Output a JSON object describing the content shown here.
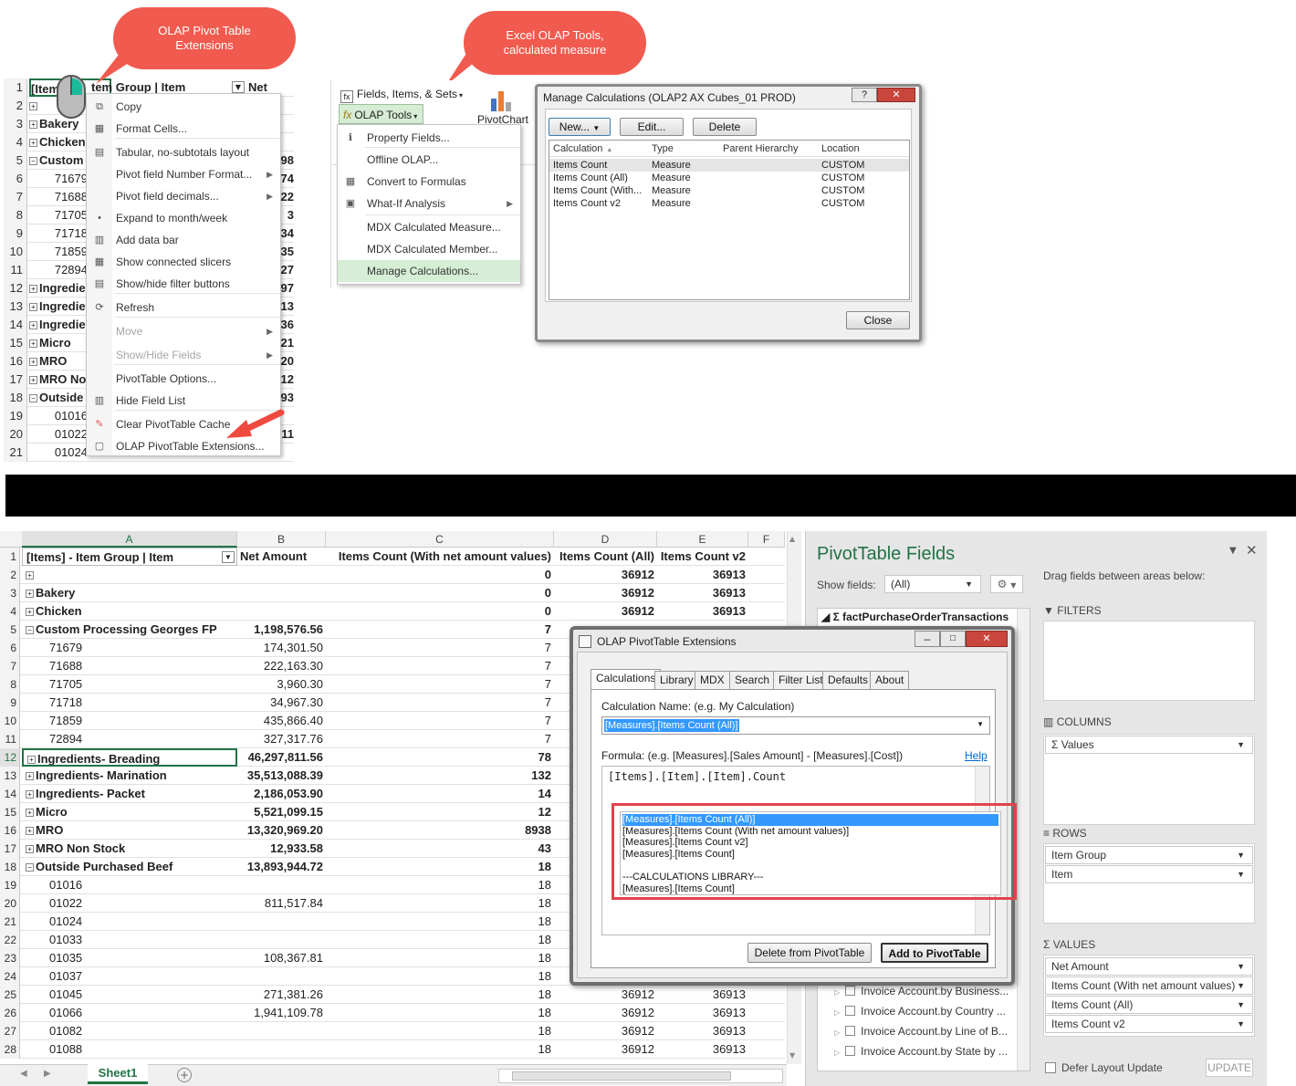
{
  "callouts": {
    "pivot_ext": "OLAP Pivot Table\nExtensions",
    "olap_tools": "Excel OLAP Tools,\ncalculated measure"
  },
  "top_grid": {
    "header_cell": "[Items] - Item Group | Item",
    "header_b": "Net Amo",
    "rows": [
      {
        "n": "1",
        "a": "[Item",
        "b": ""
      },
      {
        "n": "2",
        "a": "",
        "b": "",
        "pm": "+"
      },
      {
        "n": "3",
        "a": "Bakery",
        "b": "",
        "pm": "+"
      },
      {
        "n": "4",
        "a": "Chicken",
        "b": "",
        "pm": "+"
      },
      {
        "n": "5",
        "a": "Custom",
        "b": "98",
        "pm": "-"
      },
      {
        "n": "6",
        "a": "71679",
        "b": "74"
      },
      {
        "n": "7",
        "a": "71688",
        "b": "22"
      },
      {
        "n": "8",
        "a": "71705",
        "b": "3"
      },
      {
        "n": "9",
        "a": "71718",
        "b": "34"
      },
      {
        "n": "10",
        "a": "71859",
        "b": "35"
      },
      {
        "n": "11",
        "a": "72894",
        "b": "27"
      },
      {
        "n": "12",
        "a": "Ingredie",
        "b": "97",
        "pm": "+"
      },
      {
        "n": "13",
        "a": "Ingredie",
        "b": "13",
        "pm": "+"
      },
      {
        "n": "14",
        "a": "Ingredie",
        "b": "36",
        "pm": "+"
      },
      {
        "n": "15",
        "a": "Micro",
        "b": "21",
        "pm": "+"
      },
      {
        "n": "16",
        "a": "MRO",
        "b": "20",
        "pm": "+"
      },
      {
        "n": "17",
        "a": "MRO No",
        "b": "12",
        "pm": "+"
      },
      {
        "n": "18",
        "a": "Outside",
        "b": "93",
        "pm": "-"
      },
      {
        "n": "19",
        "a": "01016",
        "b": ""
      },
      {
        "n": "20",
        "a": "01022",
        "b": "11"
      },
      {
        "n": "21",
        "a": "01024",
        "b": ""
      }
    ]
  },
  "context_menu": [
    {
      "label": "Copy",
      "icon": "copy-icon",
      "dis": false
    },
    {
      "label": "Format Cells...",
      "icon": "format-cells-icon",
      "dis": false
    },
    {
      "label": "Tabular, no-subtotals layout",
      "icon": "table-layout-icon",
      "dis": false
    },
    {
      "label": "Pivot field Number Format...",
      "icon": "",
      "dis": false,
      "arrow": true
    },
    {
      "label": "Pivot field decimals...",
      "icon": "",
      "dis": false,
      "arrow": true
    },
    {
      "label": "Expand to month/week",
      "icon": "dot-icon",
      "dis": false
    },
    {
      "label": "Add data bar",
      "icon": "data-bar-icon",
      "dis": false
    },
    {
      "label": "Show connected slicers",
      "icon": "slicer-icon",
      "dis": false
    },
    {
      "label": "Show/hide filter buttons",
      "icon": "filter-buttons-icon",
      "dis": false
    },
    {
      "label": "Refresh",
      "icon": "refresh-icon",
      "dis": false
    },
    {
      "label": "Move",
      "icon": "",
      "dis": true,
      "arrow": true
    },
    {
      "label": "Show/Hide Fields",
      "icon": "",
      "dis": true,
      "arrow": true
    },
    {
      "label": "PivotTable Options...",
      "icon": "",
      "dis": false
    },
    {
      "label": "Hide Field List",
      "icon": "field-list-icon",
      "dis": false
    },
    {
      "label": "Clear PivotTable Cache",
      "icon": "eraser-icon",
      "dis": false
    },
    {
      "label": "OLAP PivotTable Extensions...",
      "icon": "cube-icon",
      "dis": false
    }
  ],
  "ribbon": {
    "fields_items_sets": "Fields, Items, & Sets",
    "olap_tools": "OLAP Tools",
    "pivotchart": "PivotChart",
    "menu": [
      {
        "label": "Property Fields...",
        "icon": "info-icon"
      },
      {
        "label": "Offline OLAP...",
        "icon": ""
      },
      {
        "label": "Convert to Formulas",
        "icon": "convert-icon"
      },
      {
        "label": "What-If Analysis",
        "icon": "whatif-icon",
        "arrow": true
      },
      {
        "label": "MDX Calculated Measure...",
        "icon": ""
      },
      {
        "label": "MDX Calculated Member...",
        "icon": ""
      },
      {
        "label": "Manage Calculations...",
        "icon": "",
        "selected": true
      }
    ]
  },
  "manage_calc": {
    "title": "Manage Calculations (OLAP2 AX Cubes_01 PROD)",
    "new": "New...",
    "edit": "Edit...",
    "delete": "Delete",
    "close": "Close",
    "columns": [
      "Calculation",
      "Type",
      "Parent Hierarchy",
      "Location"
    ],
    "rows": [
      {
        "name": "Items Count",
        "type": "Measure",
        "parent": "",
        "loc": "CUSTOM"
      },
      {
        "name": "Items Count (All)",
        "type": "Measure",
        "parent": "",
        "loc": "CUSTOM"
      },
      {
        "name": "Items Count (With...",
        "type": "Measure",
        "parent": "",
        "loc": "CUSTOM"
      },
      {
        "name": "Items Count v2",
        "type": "Measure",
        "parent": "",
        "loc": "CUSTOM"
      }
    ]
  },
  "grid": {
    "col_letters": [
      "A",
      "B",
      "C",
      "D",
      "E",
      "F"
    ],
    "headers": {
      "a": "[Items] - Item Group | Item",
      "b": "Net Amount",
      "c": "Items Count (With net amount values)",
      "d": "Items Count (All)",
      "e": "Items Count v2"
    },
    "rows": [
      {
        "n": "2",
        "a": "",
        "b": "",
        "c": "0",
        "d": "36912",
        "e": "36913",
        "pm": "+"
      },
      {
        "n": "3",
        "a": "Bakery",
        "b": "",
        "c": "0",
        "d": "36912",
        "e": "36913",
        "pm": "+"
      },
      {
        "n": "4",
        "a": "Chicken",
        "b": "",
        "c": "0",
        "d": "36912",
        "e": "36913",
        "pm": "+"
      },
      {
        "n": "5",
        "a": "Custom Processing Georges FP",
        "b": "1,198,576.56",
        "c": "7",
        "d": "",
        "e": "",
        "pm": "-"
      },
      {
        "n": "6",
        "a": "71679",
        "b": "174,301.50",
        "c": "7",
        "d": "",
        "e": ""
      },
      {
        "n": "7",
        "a": "71688",
        "b": "222,163.30",
        "c": "7",
        "d": "",
        "e": ""
      },
      {
        "n": "8",
        "a": "71705",
        "b": "3,960.30",
        "c": "7",
        "d": "",
        "e": ""
      },
      {
        "n": "9",
        "a": "71718",
        "b": "34,967.30",
        "c": "7",
        "d": "",
        "e": ""
      },
      {
        "n": "10",
        "a": "71859",
        "b": "435,866.40",
        "c": "7",
        "d": "",
        "e": ""
      },
      {
        "n": "11",
        "a": "72894",
        "b": "327,317.76",
        "c": "7",
        "d": "",
        "e": ""
      },
      {
        "n": "12",
        "a": "Ingredients- Breading",
        "b": "46,297,811.56",
        "c": "78",
        "d": "",
        "e": "",
        "pm": "+"
      },
      {
        "n": "13",
        "a": "Ingredients- Marination",
        "b": "35,513,088.39",
        "c": "132",
        "d": "",
        "e": "",
        "pm": "+"
      },
      {
        "n": "14",
        "a": "Ingredients- Packet",
        "b": "2,186,053.90",
        "c": "14",
        "d": "",
        "e": "",
        "pm": "+"
      },
      {
        "n": "15",
        "a": "Micro",
        "b": "5,521,099.15",
        "c": "12",
        "d": "",
        "e": "",
        "pm": "+"
      },
      {
        "n": "16",
        "a": "MRO",
        "b": "13,320,969.20",
        "c": "8938",
        "d": "",
        "e": "",
        "pm": "+"
      },
      {
        "n": "17",
        "a": "MRO Non Stock",
        "b": "12,933.58",
        "c": "43",
        "d": "",
        "e": "",
        "pm": "+"
      },
      {
        "n": "18",
        "a": "Outside Purchased Beef",
        "b": "13,893,944.72",
        "c": "18",
        "d": "",
        "e": "",
        "pm": "-"
      },
      {
        "n": "19",
        "a": "01016",
        "b": "",
        "c": "18",
        "d": "",
        "e": ""
      },
      {
        "n": "20",
        "a": "01022",
        "b": "811,517.84",
        "c": "18",
        "d": "",
        "e": ""
      },
      {
        "n": "21",
        "a": "01024",
        "b": "",
        "c": "18",
        "d": "",
        "e": ""
      },
      {
        "n": "22",
        "a": "01033",
        "b": "",
        "c": "18",
        "d": "",
        "e": ""
      },
      {
        "n": "23",
        "a": "01035",
        "b": "108,367.81",
        "c": "18",
        "d": "",
        "e": ""
      },
      {
        "n": "24",
        "a": "01037",
        "b": "",
        "c": "18",
        "d": "",
        "e": ""
      },
      {
        "n": "25",
        "a": "01045",
        "b": "271,381.26",
        "c": "18",
        "d": "36912",
        "e": "36913"
      },
      {
        "n": "26",
        "a": "01066",
        "b": "1,941,109.78",
        "c": "18",
        "d": "36912",
        "e": "36913"
      },
      {
        "n": "27",
        "a": "01082",
        "b": "",
        "c": "18",
        "d": "36912",
        "e": "36913"
      },
      {
        "n": "28",
        "a": "01088",
        "b": "",
        "c": "18",
        "d": "36912",
        "e": "36913"
      }
    ],
    "sheet_tab": "Sheet1"
  },
  "ext_dialog": {
    "title": "OLAP PivotTable Extensions",
    "tabs": [
      "Calculations",
      "Library",
      "MDX",
      "Search",
      "Filter List",
      "Defaults",
      "About"
    ],
    "calc_name_label": "Calculation Name: (e.g. My Calculation)",
    "calc_name_value": "[Measures].[Items Count (All)]",
    "formula_label": "Formula: (e.g. [Measures].[Sales Amount] - [Measures].[Cost])",
    "help": "Help",
    "formula_value": "[Items].[Item].[Item].Count",
    "list": [
      "[Measures].[Items Count (All)]",
      "[Measures].[Items Count (With net amount values)]",
      "[Measures].[Items Count v2]",
      "[Measures].[Items Count]",
      "",
      "---CALCULATIONS LIBRARY---",
      "[Measures].[Items Count]"
    ],
    "delete_btn": "Delete from PivotTable",
    "add_btn": "Add to PivotTable"
  },
  "pivot_fields": {
    "title": "PivotTable Fields",
    "show_fields": "Show fields:",
    "show_value": "(All)",
    "drag_text": "Drag fields between areas below:",
    "table_name": "factPurchaseOrderTransactions",
    "filters": "FILTERS",
    "columns": "COLUMNS",
    "rows": "ROWS",
    "values": "VALUES",
    "columns_items": [
      "Values"
    ],
    "rows_items": [
      "Item Group",
      "Item"
    ],
    "values_items": [
      "Net Amount",
      "Items Count (With net amount values)",
      "Items Count (All)",
      "Items Count v2"
    ],
    "field_list": [
      "Invoice Account.by Business...",
      "Invoice Account.by Country ...",
      "Invoice Account.by Line of B...",
      "Invoice Account.by State by ..."
    ],
    "defer": "Defer Layout Update",
    "update": "UPDATE"
  }
}
